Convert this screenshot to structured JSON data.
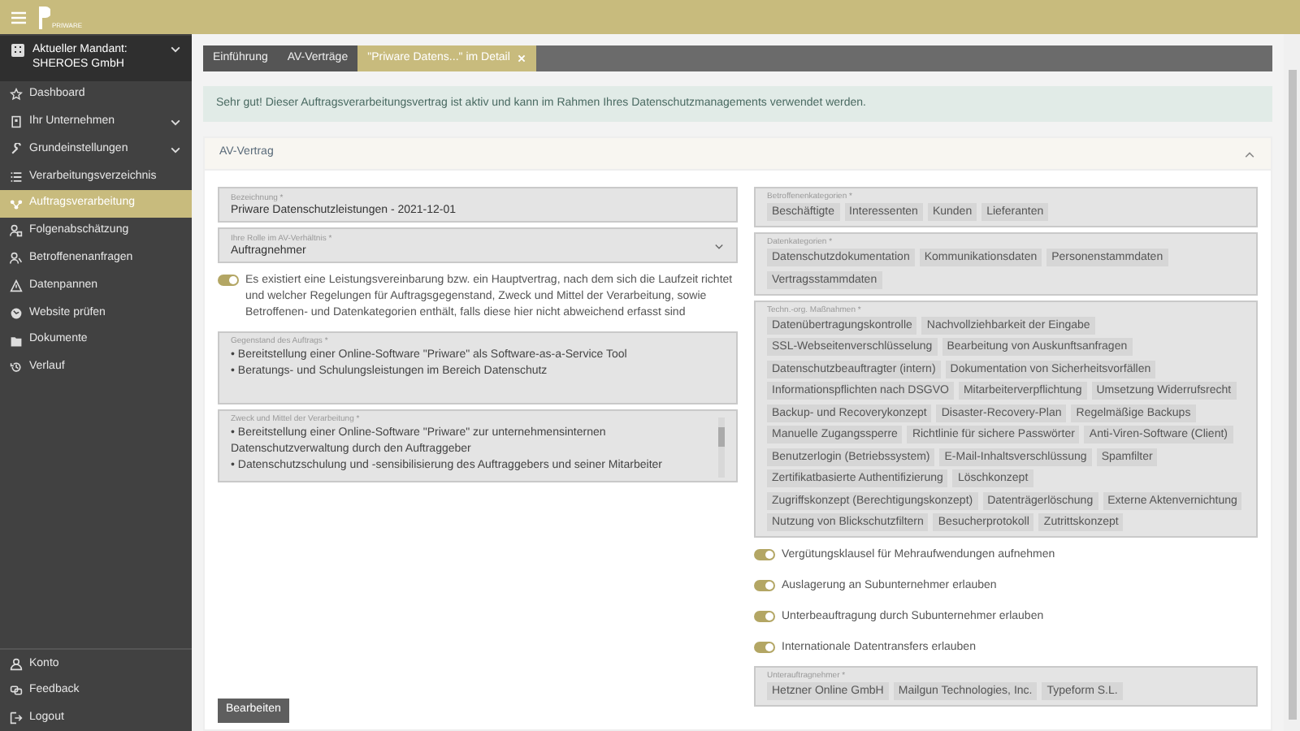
{
  "top_bar": {
    "logo_text": "PRIWARE"
  },
  "sidebar": {
    "mandant": {
      "label": "Aktueller Mandant:",
      "value": "SHEROES GmbH",
      "expandable": true
    },
    "items": [
      {
        "label": "Dashboard",
        "selected": false,
        "expandable": false
      },
      {
        "label": "Ihr Unternehmen",
        "selected": false,
        "expandable": true
      },
      {
        "label": "Grundeinstellungen",
        "selected": false,
        "expandable": true
      },
      {
        "label": "Verarbeitungsverzeichnis",
        "selected": false,
        "expandable": false
      },
      {
        "label": "Auftragsverarbeitung",
        "selected": true,
        "expandable": false
      },
      {
        "label": "Folgenabschätzung",
        "selected": false,
        "expandable": false
      },
      {
        "label": "Betroffenenanfragen",
        "selected": false,
        "expandable": false
      },
      {
        "label": "Datenpannen",
        "selected": false,
        "expandable": false
      },
      {
        "label": "Website prüfen",
        "selected": false,
        "expandable": false
      },
      {
        "label": "Dokumente",
        "selected": false,
        "expandable": false
      },
      {
        "label": "Verlauf",
        "selected": false,
        "expandable": false
      }
    ],
    "footer_items": [
      {
        "label": "Konto"
      },
      {
        "label": "Feedback"
      },
      {
        "label": "Logout"
      }
    ]
  },
  "tabs": [
    {
      "label": "Einführung",
      "selected": false,
      "closable": false
    },
    {
      "label": "AV-Verträge",
      "selected": false,
      "closable": false
    },
    {
      "label": "\"Priware Datens...\" im Detail",
      "selected": true,
      "closable": true
    }
  ],
  "alert": "Sehr gut! Dieser Auftragsverarbeitungsvertrag ist aktiv und kann im Rahmen Ihres Datenschutzmanagements verwendet werden.",
  "card": {
    "title": "AV-Vertrag",
    "expanded": true
  },
  "left_fields": [
    {
      "kind": "text",
      "label": "Bezeichnung *",
      "value": "Priware Datenschutzleistungen - 2021-12-01"
    },
    {
      "kind": "select",
      "label": "Ihre Rolle im AV-Verhältnis *",
      "value": "Auftragnehmer"
    },
    {
      "kind": "toggle",
      "label": "Es existiert eine Leistungsvereinbarung bzw. ein Hauptvertrag, nach dem sich die Laufzeit richtet und welcher Regelungen für Auftragsgegenstand, Zweck und Mittel der Verarbeitung, sowie Betroffenen- und Datenkategorien enthält, falls diese hier nicht abweichend erfasst sind",
      "on": true
    },
    {
      "kind": "textarea",
      "label": "Gegenstand des Auftrags *",
      "lines": [
        "• Bereitstellung einer Online-Software \"Priware\" als Software-as-a-Service Tool",
        "• Beratungs- und Schulungsleistungen im Bereich Datenschutz"
      ],
      "scrollable": false
    },
    {
      "kind": "textarea",
      "label": "Zweck und Mittel der Verarbeitung *",
      "lines": [
        "• Bereitstellung einer Online-Software \"Priware\" zur unternehmensinternen Datenschutzverwaltung durch den Auftraggeber",
        "• Datenschutzschulung und -sensibilisierung des Auftraggebers und seiner Mitarbeiter"
      ],
      "scrollable": true
    }
  ],
  "right_fields": [
    {
      "kind": "chips",
      "label": "Betroffenenkategorien *",
      "chips": [
        "Beschäftigte",
        "Interessenten",
        "Kunden",
        "Lieferanten"
      ]
    },
    {
      "kind": "chips",
      "label": "Datenkategorien *",
      "chips": [
        "Datenschutzdokumentation",
        "Kommunikationsdaten",
        "Personenstammdaten",
        "Vertragsstammdaten"
      ]
    },
    {
      "kind": "chips",
      "label": "Techn.-org. Maßnahmen *",
      "chips": [
        "Datenübertragungskontrolle",
        "Nachvollziehbarkeit der Eingabe",
        "SSL-Webseitenverschlüsselung",
        "Bearbeitung von Auskunftsanfragen",
        "Datenschutzbeauftragter (intern)",
        "Dokumentation von Sicherheitsvorfällen",
        "Informationspflichten nach DSGVO",
        "Mitarbeiterverpflichtung",
        "Umsetzung Widerrufsrecht",
        "Backup- und Recoverykonzept",
        "Disaster-Recovery-Plan",
        "Regelmäßige Backups",
        "Manuelle Zugangssperre",
        "Richtlinie für sichere Passwörter",
        "Anti-Viren-Software (Client)",
        "Benutzerlogin (Betriebssystem)",
        "E-Mail-Inhaltsverschlüssung",
        "Spamfilter",
        "Zertifikatbasierte Authentifizierung",
        "Löschkonzept",
        "Zugriffskonzept (Berechtigungskonzept)",
        "Datenträgerlöschung",
        "Externe Aktenvernichtung",
        "Nutzung von Blickschutzfiltern",
        "Besucherprotokoll",
        "Zutrittskonzept"
      ]
    },
    {
      "kind": "toggle",
      "label": "Vergütungsklausel für Mehraufwendungen aufnehmen",
      "on": true
    },
    {
      "kind": "toggle",
      "label": "Auslagerung an Subunternehmer erlauben",
      "on": true
    },
    {
      "kind": "toggle",
      "label": "Unterbeauftragung durch Subunternehmer erlauben",
      "on": true
    },
    {
      "kind": "toggle",
      "label": "Internationale Datentransfers erlauben",
      "on": true
    },
    {
      "kind": "chips",
      "label": "Unterauftragnehmer *",
      "chips": [
        "Hetzner Online GmbH",
        "Mailgun Technologies, Inc.",
        "Typeform S.L."
      ]
    }
  ],
  "button": "Bearbeiten"
}
